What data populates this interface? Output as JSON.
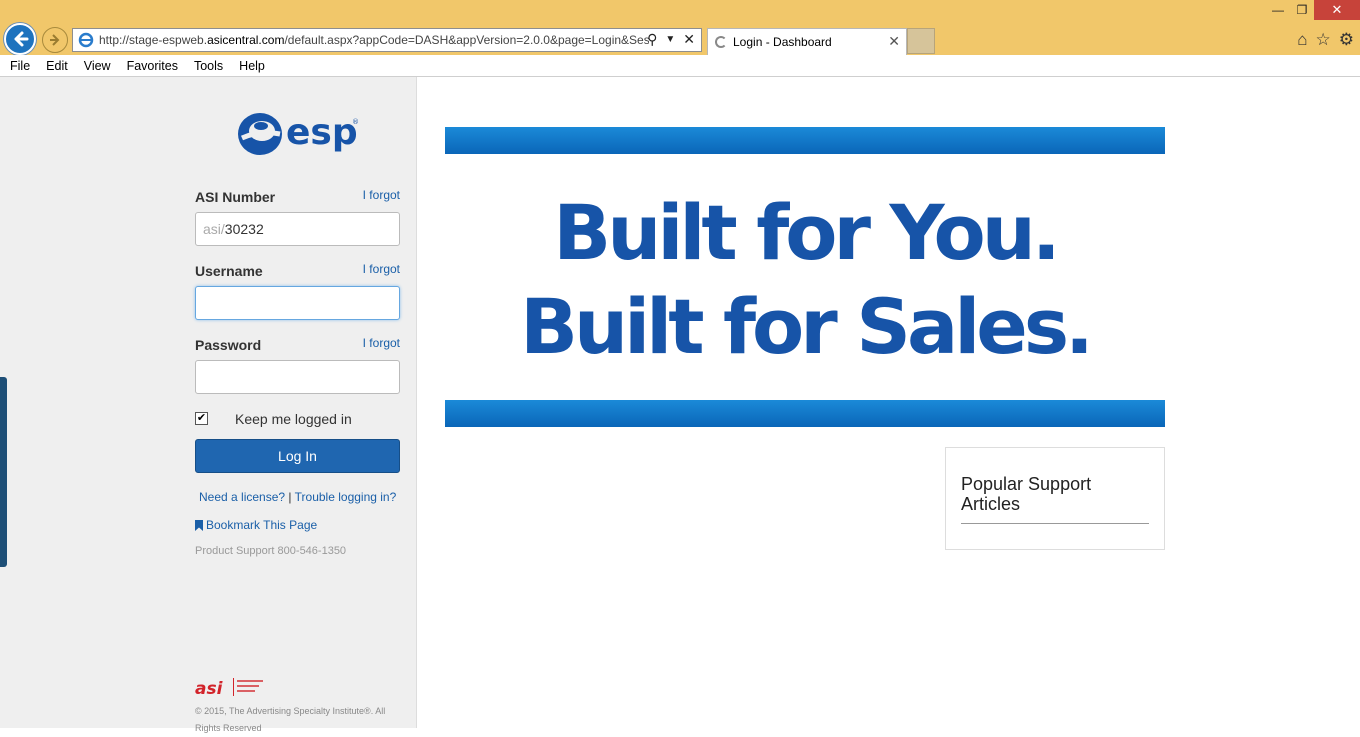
{
  "browser": {
    "url_prefix": "http://stage-espweb.",
    "url_domain": "asicentral.com",
    "url_suffix": "/default.aspx?appCode=DASH&appVersion=2.0.0&page=Login&Ses",
    "tab_title": "Login - Dashboard",
    "menu": [
      "File",
      "Edit",
      "View",
      "Favorites",
      "Tools",
      "Help"
    ]
  },
  "login": {
    "asi_label": "ASI Number",
    "asi_prefix": "asi/",
    "asi_value": "30232",
    "username_label": "Username",
    "username_value": "",
    "password_label": "Password",
    "password_value": "",
    "forgot": "I forgot",
    "keep_logged_in": "Keep me logged in",
    "keep_checked": true,
    "login_button": "Log In",
    "need_license": "Need a license?",
    "separator": "|",
    "trouble": "Trouble logging in?",
    "bookmark": "Bookmark This Page",
    "product_support": "Product Support 800-546-1350",
    "copyright": "© 2015, The Advertising Specialty Institute®. All Rights Reserved"
  },
  "hero": {
    "line1": "Built for You.",
    "line2": "Built for Sales."
  },
  "support_box": {
    "title": "Popular Support Articles"
  },
  "colors": {
    "brand_blue": "#1754a8",
    "button_blue": "#1f66b0",
    "bar_blue": "#0a66b8",
    "chrome_gold": "#f1c76a",
    "asi_red": "#d2232a"
  }
}
